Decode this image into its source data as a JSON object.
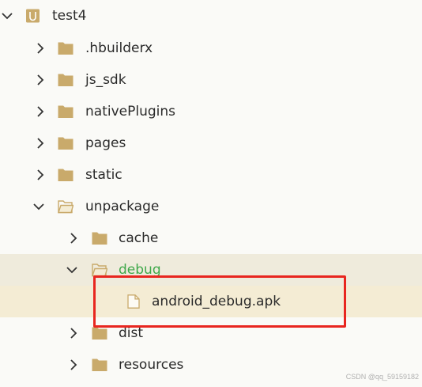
{
  "tree": {
    "root": {
      "label": "test4"
    },
    "items": [
      {
        "label": ".hbuilderx"
      },
      {
        "label": "js_sdk"
      },
      {
        "label": "nativePlugins"
      },
      {
        "label": "pages"
      },
      {
        "label": "static"
      },
      {
        "label": "unpackage"
      },
      {
        "label": "cache"
      },
      {
        "label": "debug"
      },
      {
        "label": "android_debug.apk"
      },
      {
        "label": "dist"
      },
      {
        "label": "resources"
      }
    ]
  },
  "colors": {
    "folder": "#c9aa6b",
    "selected_bg": "#efebdc",
    "active_label": "#3fa84a",
    "annotation_box": "#e8261f"
  },
  "watermark": "CSDN @qq_59159182"
}
